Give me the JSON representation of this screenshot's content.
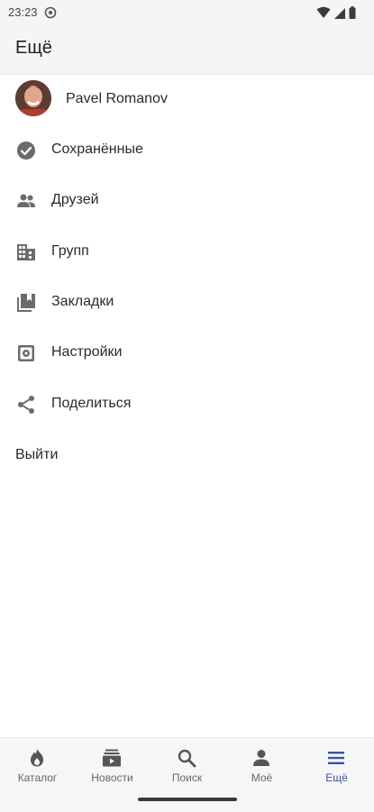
{
  "status_bar": {
    "time": "23:23",
    "icons": [
      "settings-gear-icon",
      "wifi-icon",
      "signal-icon",
      "battery-icon"
    ]
  },
  "app_bar": {
    "title": "Ещё"
  },
  "profile": {
    "name": "Pavel Romanov"
  },
  "menu": {
    "items": [
      {
        "label": "Сохранённые",
        "icon": "check-circle-icon"
      },
      {
        "label": "Друзей",
        "icon": "people-icon"
      },
      {
        "label": "Групп",
        "icon": "building-icon"
      },
      {
        "label": "Закладки",
        "icon": "bookmarks-icon"
      },
      {
        "label": "Настройки",
        "icon": "settings-icon"
      },
      {
        "label": "Поделиться",
        "icon": "share-icon"
      }
    ],
    "logout_label": "Выйти"
  },
  "bottom_nav": {
    "items": [
      {
        "label": "Каталог",
        "icon": "flame-icon"
      },
      {
        "label": "Новости",
        "icon": "news-icon"
      },
      {
        "label": "Поиск",
        "icon": "search-icon"
      },
      {
        "label": "Моё",
        "icon": "person-icon"
      },
      {
        "label": "Ещё",
        "icon": "menu-icon"
      }
    ],
    "active_label": "Ещё",
    "active_color": "#3a54a8",
    "inactive_color": "#666666"
  }
}
